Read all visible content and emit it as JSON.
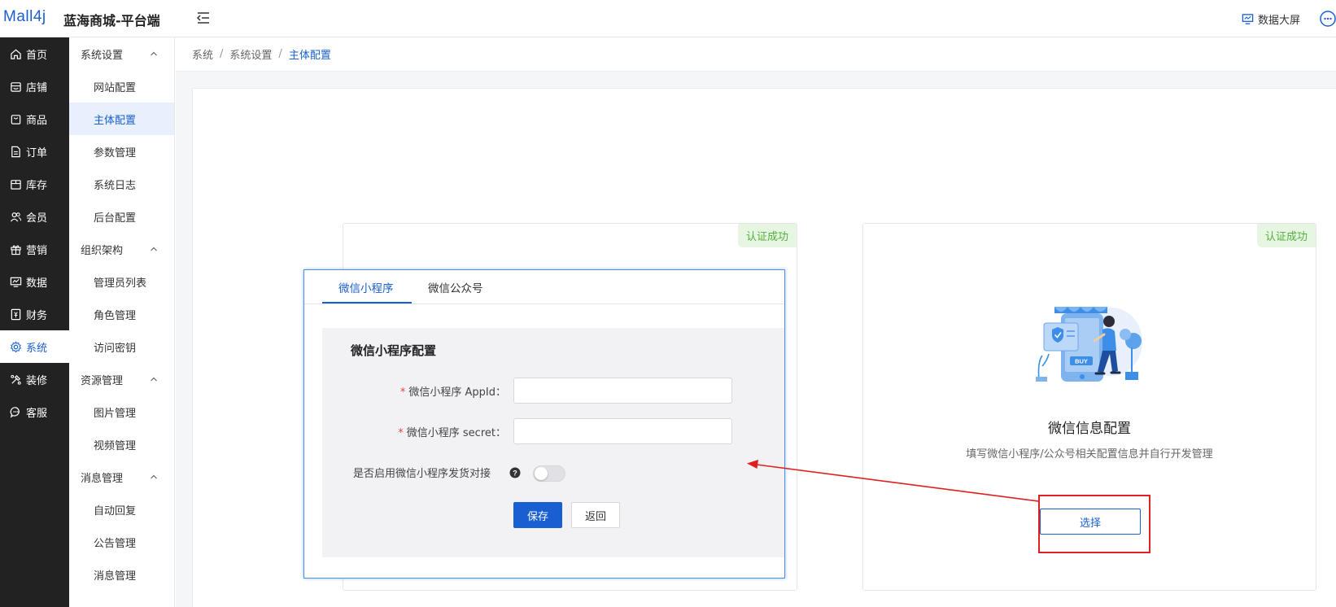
{
  "header": {
    "logo": "Mall4j",
    "site_name": "蓝海商城-平台端",
    "bigscreen_label": "数据大屏"
  },
  "sidebar": {
    "items": [
      {
        "label": "首页",
        "icon": "home-icon"
      },
      {
        "label": "店铺",
        "icon": "store-icon"
      },
      {
        "label": "商品",
        "icon": "bag-icon"
      },
      {
        "label": "订单",
        "icon": "document-icon"
      },
      {
        "label": "库存",
        "icon": "box-icon"
      },
      {
        "label": "会员",
        "icon": "users-icon"
      },
      {
        "label": "营销",
        "icon": "gift-icon"
      },
      {
        "label": "数据",
        "icon": "chart-icon"
      },
      {
        "label": "财务",
        "icon": "finance-icon"
      },
      {
        "label": "系统",
        "icon": "gear-icon",
        "active": true
      },
      {
        "label": "装修",
        "icon": "decorate-icon"
      },
      {
        "label": "客服",
        "icon": "chat-icon"
      }
    ]
  },
  "subnav": {
    "groups": [
      {
        "title": "系统设置",
        "items": [
          "网站配置",
          "主体配置",
          "参数管理",
          "系统日志",
          "后台配置"
        ]
      },
      {
        "title": "组织架构",
        "items": [
          "管理员列表",
          "角色管理",
          "访问密钥"
        ]
      },
      {
        "title": "资源管理",
        "items": [
          "图片管理",
          "视频管理"
        ]
      },
      {
        "title": "消息管理",
        "items": [
          "自动回复",
          "公告管理",
          "消息管理"
        ]
      }
    ],
    "active": "主体配置"
  },
  "breadcrumb": {
    "items": [
      "系统",
      "系统设置",
      "主体配置"
    ]
  },
  "cards": {
    "left_badge": "认证成功",
    "right_badge": "认证成功",
    "right_title": "微信信息配置",
    "right_desc": "填写微信小程序/公众号相关配置信息并自行开发管理",
    "select_label": "选择"
  },
  "dialog": {
    "tabs": [
      "微信小程序",
      "微信公众号"
    ],
    "active_tab": "微信小程序",
    "form_title": "微信小程序配置",
    "fields": [
      {
        "label": "微信小程序 AppId：",
        "value": "",
        "required": true
      },
      {
        "label": "微信小程序 secret：",
        "value": "",
        "required": true
      }
    ],
    "required_mark": "*",
    "toggle_label": "是否启用微信小程序发货对接",
    "toggle_on": false,
    "save_label": "保存",
    "back_label": "返回"
  },
  "illustration_badge": "BUY",
  "colors": {
    "primary": "#1a5fd1",
    "sidebar_bg": "#222222",
    "success_bg": "#e6f6e3",
    "success_text": "#52b03c",
    "annotation": "#e02020"
  }
}
